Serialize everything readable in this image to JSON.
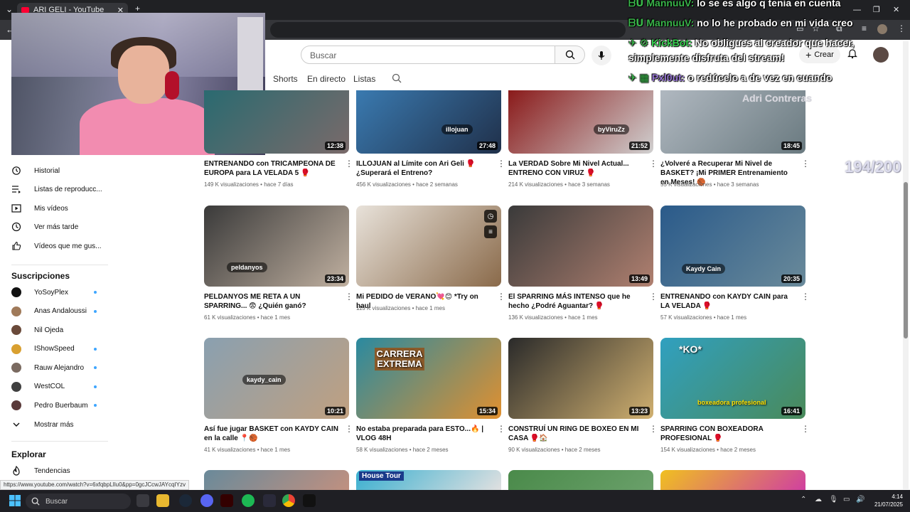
{
  "browser": {
    "tab_title": "ARI GELI - YouTube",
    "status_url": "https://www.youtube.com/watch?v=6xfqbpLIlu0&pp=0gcJCcwJAYcqIYzv"
  },
  "chat": [
    {
      "user": "MannuuV:",
      "msg": "lo se es algo q tenia en cuenta",
      "kind": "mannu"
    },
    {
      "user": "MannuuV:",
      "msg": "no lo he probado en mi vida creo",
      "kind": "mannu"
    },
    {
      "user": "KickBot:",
      "msg": "No obligues al creador que hacer,",
      "kind": "kick"
    },
    {
      "user": "",
      "msg": "simplemente disfruta del stream!",
      "kind": "kick"
    },
    {
      "user": "Pxl0ut:",
      "msg": "o redúcelo a de vez en cuando",
      "kind": "pxl"
    },
    {
      "user": "",
      "msg": "Adri Contreras",
      "kind": "faded"
    }
  ],
  "overlay_counter": "194/200",
  "header": {
    "search_placeholder": "Buscar",
    "create_label": "Crear"
  },
  "channel_tabs": [
    "Shorts",
    "En directo",
    "Listas"
  ],
  "sidebar": {
    "items": [
      {
        "label": "Historial",
        "icon": "history-icon"
      },
      {
        "label": "Listas de reproducc...",
        "icon": "playlist-icon"
      },
      {
        "label": "Mis vídeos",
        "icon": "my-videos-icon"
      },
      {
        "label": "Ver más tarde",
        "icon": "watch-later-icon"
      },
      {
        "label": "Vídeos que me gus...",
        "icon": "like-icon"
      }
    ],
    "subscriptions_heading": "Suscripciones",
    "subscriptions": [
      {
        "name": "YoSoyPlex",
        "color": "#111111"
      },
      {
        "name": "Anas Andaloussi",
        "color": "#a07a5a"
      },
      {
        "name": "Nil Ojeda",
        "color": "#6a4a3a"
      },
      {
        "name": "IShowSpeed",
        "color": "#d9a030"
      },
      {
        "name": "Rauw Alejandro",
        "color": "#7a6a60"
      },
      {
        "name": "WestCOL",
        "color": "#404040"
      },
      {
        "name": "Pedro Buerbaum",
        "color": "#5a3a3a"
      }
    ],
    "show_more": "Mostrar más",
    "explore_heading": "Explorar",
    "explore_items": [
      {
        "label": "Tendencias",
        "icon": "trending-icon"
      }
    ]
  },
  "videos": [
    {
      "title": "ENTRENANDO con TRICAMPEONA DE EUROPA para LA VELADA 5 🥊",
      "views": "149 K visualizaciones",
      "age": "hace 7 días",
      "duration": "12:38",
      "colors": [
        "#2a6a70",
        "#7a6a6a"
      ],
      "badge": ""
    },
    {
      "title": "ILLOJUAN al Límite con Ari Geli 🥊 ¿Superará el Entreno?",
      "views": "456 K visualizaciones",
      "age": "hace 2 semanas",
      "duration": "27:48",
      "colors": [
        "#3a7ab0",
        "#20304a"
      ],
      "badge": "illojuan"
    },
    {
      "title": "La VERDAD Sobre Mi Nivel Actual... ENTRENO CON VIRUZ 🥊",
      "views": "214 K visualizaciones",
      "age": "hace 3 semanas",
      "duration": "21:52",
      "colors": [
        "#8a1a1a",
        "#d0d0d0"
      ],
      "badge": "byViruZz"
    },
    {
      "title": "¿Volveré a Recuperar Mi Nivel de BASKET? ¡Mi PRIMER Entrenamiento en Meses! 🏀",
      "views": "55 K visualizaciones",
      "age": "hace 3 semanas",
      "duration": "18:45",
      "colors": [
        "#b0b8c0",
        "#6a7a80"
      ],
      "badge": ""
    },
    {
      "title": "PELDANYOS ME RETA A UN SPARRING... 😨 ¿Quién ganó?",
      "views": "61 K visualizaciones",
      "age": "hace 1 mes",
      "duration": "23:34",
      "colors": [
        "#3a3a3a",
        "#c0b0a0"
      ],
      "badge": "peldanyos"
    },
    {
      "title": "Mi PEDIDO de VERANO💘😊 *Try on haul",
      "views": "115 K visualizaciones",
      "age": "hace 1 mes",
      "duration": "",
      "colors": [
        "#e8e2da",
        "#8a6a4a"
      ],
      "badge": ""
    },
    {
      "title": "El SPARRING MÁS INTENSO que he hecho ¿Podré Aguantar? 🥊",
      "views": "136 K visualizaciones",
      "age": "hace 1 mes",
      "duration": "13:49",
      "colors": [
        "#3a3a3a",
        "#b08070"
      ],
      "badge": ""
    },
    {
      "title": "ENTRENANDO con KAYDY CAIN para LA VELADA 🥊",
      "views": "57 K visualizaciones",
      "age": "hace 1 mes",
      "duration": "20:35",
      "colors": [
        "#2a5a8a",
        "#6a8a9a"
      ],
      "badge": "Kaydy Cain"
    },
    {
      "title": "Así fue jugar BASKET con KAYDY CAIN en la calle 📍🏀",
      "views": "41 K visualizaciones",
      "age": "hace 1 mes",
      "duration": "10:21",
      "colors": [
        "#8aa0b0",
        "#c0a080"
      ],
      "badge": "kaydy_cain"
    },
    {
      "title": "No estaba preparada para ESTO...🔥 | VLOG 48H",
      "views": "58 K visualizaciones",
      "age": "hace 2 meses",
      "duration": "15:34",
      "colors": [
        "#2a8aa0",
        "#e09030"
      ],
      "badge": "CARRERA EXTREMA"
    },
    {
      "title": "CONSTRUÍ UN RING DE BOXEO EN MI CASA 🥊🏠",
      "views": "90 K visualizaciones",
      "age": "hace 2 meses",
      "duration": "13:23",
      "colors": [
        "#2a2a2a",
        "#d0b070"
      ],
      "badge": ""
    },
    {
      "title": "SPARRING CON BOXEADORA PROFESIONAL 🥊",
      "views": "154 K visualizaciones",
      "age": "hace 2 meses",
      "duration": "16:41",
      "colors": [
        "#30a0c0",
        "#4a8a5a"
      ],
      "badge": "boxeadora profesional"
    }
  ],
  "next_row": [
    {
      "colors": [
        "#6a8a9a",
        "#c09080"
      ],
      "badge": ""
    },
    {
      "colors": [
        "#3ab0d0",
        "#e0e0e0"
      ],
      "badge": "House Tour"
    },
    {
      "colors": [
        "#4a8a4a",
        "#6aa06a"
      ],
      "badge": ""
    },
    {
      "colors": [
        "#f0c020",
        "#d040a0"
      ],
      "badge": ""
    }
  ],
  "taskbar": {
    "search_placeholder": "Buscar",
    "time": "4:14",
    "date": "21/07/2025"
  }
}
